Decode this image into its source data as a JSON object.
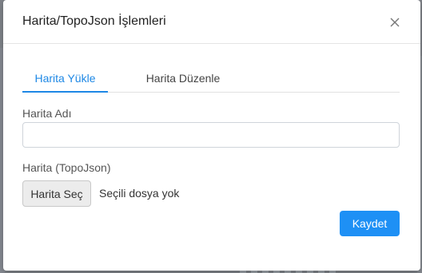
{
  "modal": {
    "title": "Harita/TopoJson İşlemleri",
    "close_icon": "close-icon",
    "tabs": [
      {
        "label": "Harita Yükle",
        "active": true
      },
      {
        "label": "Harita Düzenle",
        "active": false
      }
    ],
    "form": {
      "map_name_label": "Harita Adı",
      "map_name_value": "",
      "file_label": "Harita (TopoJson)",
      "file_button_label": "Harita Seç",
      "file_status": "Seçili dosya yok"
    },
    "save_label": "Kaydet"
  },
  "colors": {
    "accent": "#1e88e5",
    "save_button": "#1e90f5",
    "backdrop": "#7f8389"
  }
}
